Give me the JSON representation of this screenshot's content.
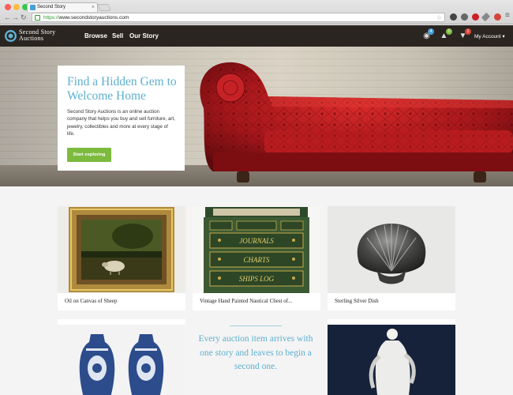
{
  "browser": {
    "tab_title": "Second Story",
    "url_scheme": "https://",
    "url_host": "www.secondstoryauctions.com"
  },
  "nav": {
    "logo_line1": "Second Story",
    "logo_line2": "Auctions",
    "links": [
      "Browse",
      "Sell",
      "Our Story"
    ],
    "badges": {
      "watch": "4",
      "likes": "0",
      "dislikes": "1"
    },
    "account_label": "My Account ▾"
  },
  "hero": {
    "title": "Find a Hidden Gem to Welcome Home",
    "body": "Second Story Auctions is an online auction company that helps you buy and sell furniture, art, jewelry, collectibles and more at every stage of life.",
    "button": "Start exploring"
  },
  "items": [
    {
      "caption": "Oil on Canvas of Sheep"
    },
    {
      "caption": "Vintage Hand Painted Nautical Chest of..."
    },
    {
      "caption": "Sterling Silver Dish"
    }
  ],
  "chest_labels": [
    "JOURNALS",
    "CHARTS",
    "SHIPS LOG"
  ],
  "story": "Every auction item arrives with one story and leaves to begin a second one.",
  "colors": {
    "accent_blue": "#5db0d0",
    "button_green": "#7dbb3f",
    "nav_bg": "#2b2521",
    "badge_blue": "#4a9fd4",
    "badge_green": "#7dbb3f",
    "badge_red": "#d9463c"
  }
}
